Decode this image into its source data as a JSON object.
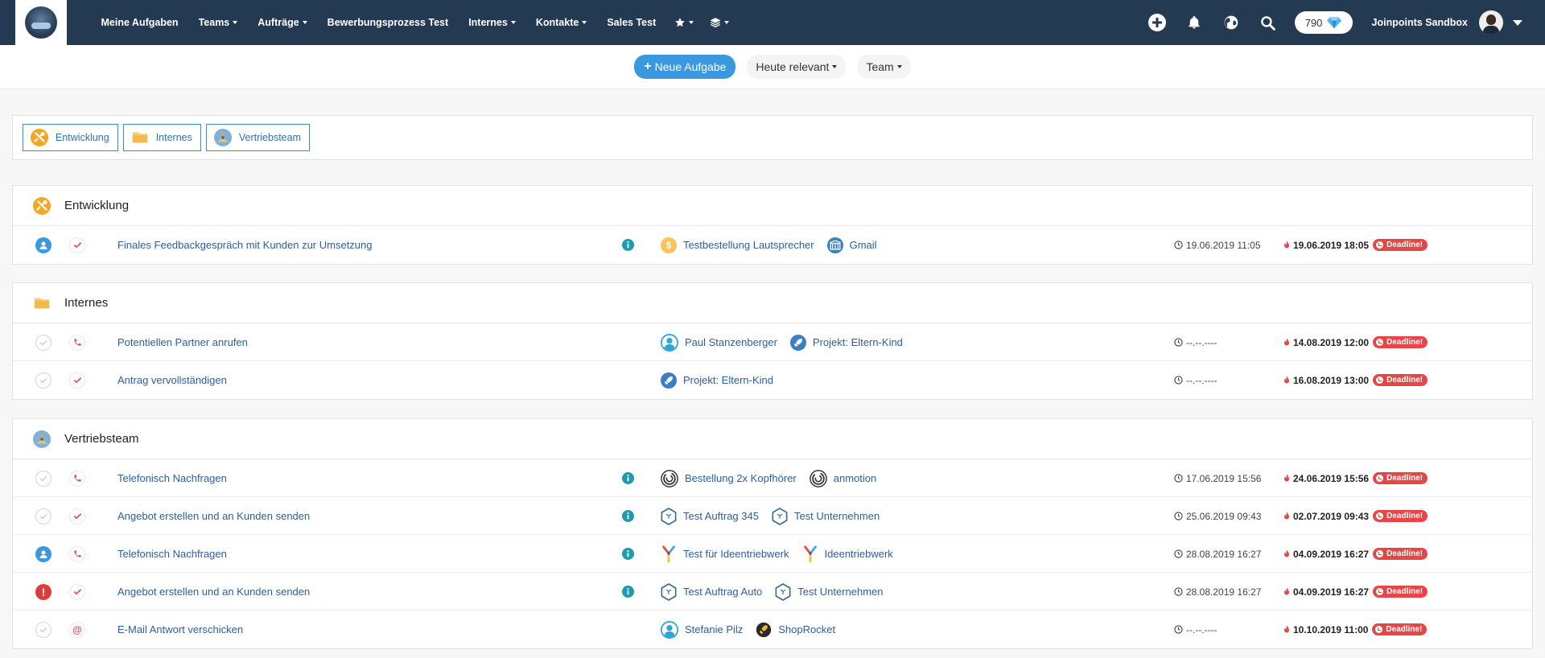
{
  "nav": {
    "items": [
      {
        "label": "Meine Aufgaben",
        "dropdown": false
      },
      {
        "label": "Teams",
        "dropdown": true
      },
      {
        "label": "Aufträge",
        "dropdown": true
      },
      {
        "label": "Bewerbungsprozess Test",
        "dropdown": false
      },
      {
        "label": "Internes",
        "dropdown": true
      },
      {
        "label": "Kontakte",
        "dropdown": true
      },
      {
        "label": "Sales Test",
        "dropdown": false
      }
    ],
    "points": "790",
    "account_name": "Joinpoints Sandbox"
  },
  "toolbar": {
    "new_task_label": "Neue Aufgabe",
    "filter_relevance_label": "Heute relevant",
    "filter_team_label": "Team"
  },
  "chips": [
    {
      "label": "Entwicklung",
      "icon": "tools-icon"
    },
    {
      "label": "Internes",
      "icon": "folder-icon"
    },
    {
      "label": "Vertriebsteam",
      "icon": "team-avatar-icon"
    }
  ],
  "sections": [
    {
      "title": "Entwicklung",
      "icon": "tools-icon",
      "rows": [
        {
          "status": "user",
          "type": "check",
          "title": "Finales Feedbackgespräch mit Kunden zur Umsetzung",
          "info": true,
          "related": [
            {
              "label": "Testbestellung Lautsprecher",
              "icon": "dollar"
            },
            {
              "label": "Gmail",
              "icon": "gmail"
            }
          ],
          "start": "19.06.2019 11:05",
          "due": "19.06.2019 18:05",
          "badge": "Deadline!"
        }
      ]
    },
    {
      "title": "Internes",
      "icon": "folder-icon",
      "rows": [
        {
          "status": "done",
          "type": "phone",
          "title": "Potentiellen Partner anrufen",
          "info": false,
          "related": [
            {
              "label": "Paul Stanzenberger",
              "icon": "person"
            },
            {
              "label": "Projekt: Eltern-Kind",
              "icon": "rocket"
            }
          ],
          "start": "--.--.----",
          "due": "14.08.2019 12:00",
          "badge": "Deadline!"
        },
        {
          "status": "done",
          "type": "check",
          "title": "Antrag vervollständigen",
          "info": false,
          "related": [
            {
              "label": "Projekt: Eltern-Kind",
              "icon": "rocket"
            }
          ],
          "start": "--.--.----",
          "due": "16.08.2019 13:00",
          "badge": "Deadline!"
        }
      ]
    },
    {
      "title": "Vertriebsteam",
      "icon": "team-avatar-icon",
      "rows": [
        {
          "status": "done",
          "type": "phone",
          "title": "Telefonisch Nachfragen",
          "info": true,
          "related": [
            {
              "label": "Bestellung 2x Kopfhörer",
              "icon": "swirl"
            },
            {
              "label": "anmotion",
              "icon": "swirl"
            }
          ],
          "start": "17.06.2019 15:56",
          "due": "24.06.2019 15:56",
          "badge": "Deadline!"
        },
        {
          "status": "done",
          "type": "check",
          "title": "Angebot erstellen und an Kunden senden",
          "info": true,
          "related": [
            {
              "label": "Test Auftrag 345",
              "icon": "hex"
            },
            {
              "label": "Test Unternehmen",
              "icon": "hex"
            }
          ],
          "start": "25.06.2019 09:43",
          "due": "02.07.2019 09:43",
          "badge": "Deadline!"
        },
        {
          "status": "user",
          "type": "phone",
          "title": "Telefonisch Nachfragen",
          "info": true,
          "related": [
            {
              "label": "Test für Ideentriebwerk",
              "icon": "ylogo"
            },
            {
              "label": "Ideentriebwerk",
              "icon": "ylogo"
            }
          ],
          "start": "28.08.2019 16:27",
          "due": "04.09.2019 16:27",
          "badge": "Deadline!"
        },
        {
          "status": "alert",
          "type": "check",
          "title": "Angebot erstellen und an Kunden senden",
          "info": true,
          "related": [
            {
              "label": "Test Auftrag Auto",
              "icon": "hex"
            },
            {
              "label": "Test Unternehmen",
              "icon": "hex"
            }
          ],
          "start": "28.08.2019 16:27",
          "due": "04.09.2019 16:27",
          "badge": "Deadline!"
        },
        {
          "status": "done",
          "type": "email",
          "title": "E-Mail Antwort verschicken",
          "info": false,
          "related": [
            {
              "label": "Stefanie Pilz",
              "icon": "person"
            },
            {
              "label": "ShopRocket",
              "icon": "shoprocket"
            }
          ],
          "start": "--.--.----",
          "due": "10.10.2019 11:00",
          "badge": "Deadline!"
        }
      ]
    }
  ],
  "colors": {
    "navbar": "#233a52",
    "accent": "#3a98e0",
    "link": "#2c5f9e",
    "deadline": "#e64646",
    "type_icon": "#e0457b"
  }
}
